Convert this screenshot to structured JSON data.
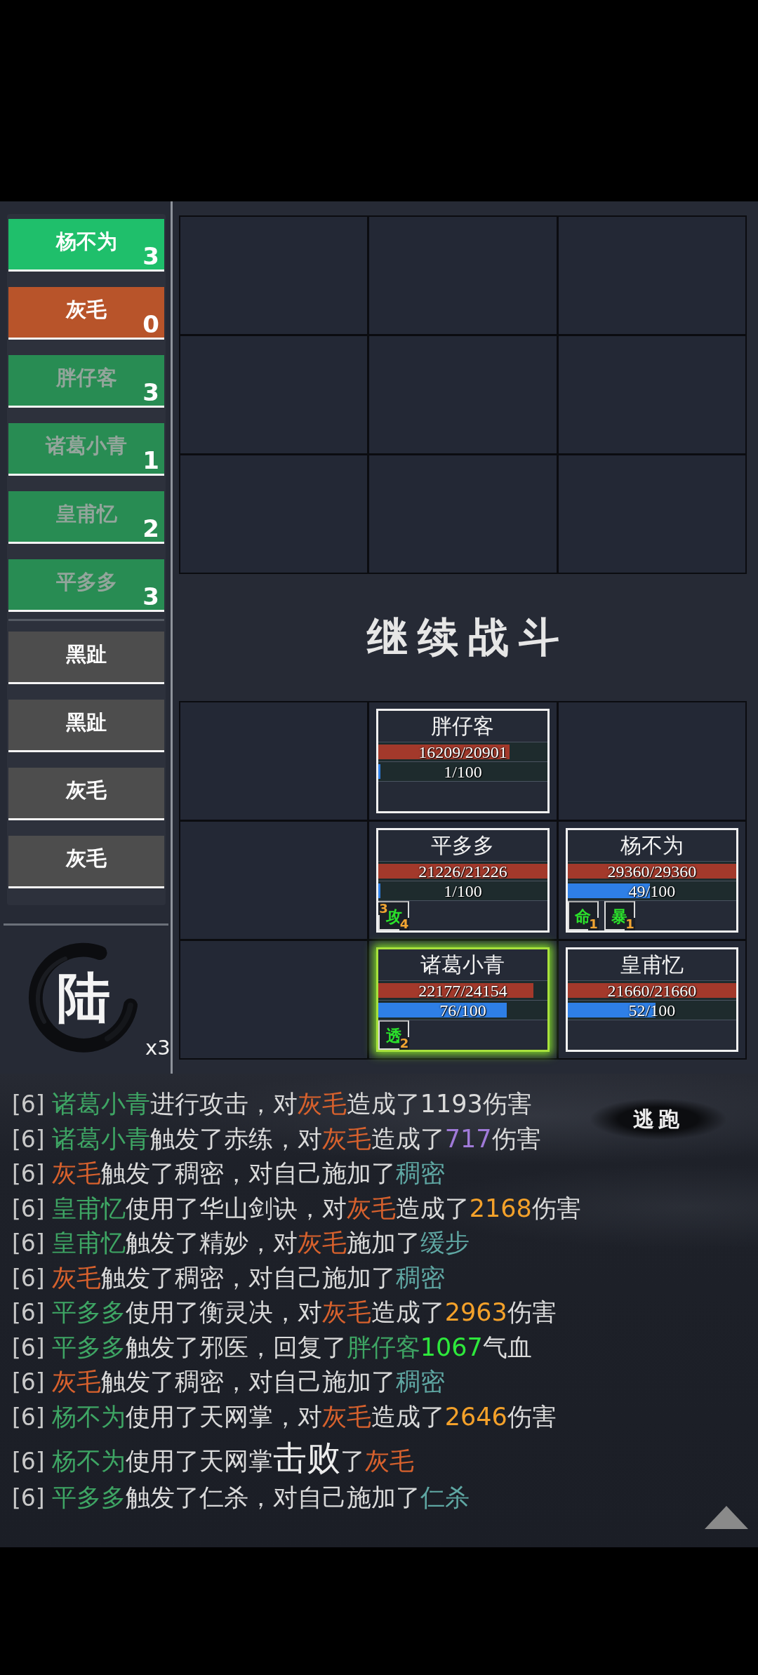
{
  "battle_queue": {
    "groups": [
      {
        "items": [
          {
            "name": "杨不为",
            "count": "3",
            "color": "#1fbf6b",
            "dimmed": false
          },
          {
            "name": "灰毛",
            "count": "0",
            "color": "#b8542a",
            "dimmed": false
          },
          {
            "name": "胖仔客",
            "count": "3",
            "color": "#288c53",
            "dimmed": true
          },
          {
            "name": "诸葛小青",
            "count": "1",
            "color": "#288c53",
            "dimmed": true
          },
          {
            "name": "皇甫忆",
            "count": "2",
            "color": "#288c53",
            "dimmed": true
          },
          {
            "name": "平多多",
            "count": "3",
            "color": "#288c53",
            "dimmed": true
          }
        ]
      },
      {
        "items": [
          {
            "name": "黑趾",
            "color": "#4d4d4d",
            "dimmed": false
          },
          {
            "name": "黑趾",
            "color": "#4d4d4d",
            "dimmed": false
          },
          {
            "name": "灰毛",
            "color": "#4d4d4d",
            "dimmed": false
          },
          {
            "name": "灰毛",
            "color": "#4d4d4d",
            "dimmed": false
          }
        ]
      }
    ]
  },
  "round_indicator": {
    "numeral": "陆",
    "speed": "x3"
  },
  "enemy_formation": {
    "slots": [
      {
        "occupied": false
      },
      {
        "occupied": false
      },
      {
        "occupied": false
      },
      {
        "occupied": false
      },
      {
        "occupied": false
      },
      {
        "occupied": false
      },
      {
        "occupied": false
      },
      {
        "occupied": false
      },
      {
        "occupied": false
      }
    ]
  },
  "continue_button": "继续战斗",
  "ally_formation": {
    "slots": [
      {
        "occupied": false
      },
      {
        "occupied": true,
        "name": "胖仔客",
        "hp": {
          "text": "16209/20901",
          "level": 0.775
        },
        "energy": {
          "text": "1/100",
          "level": 0.01
        },
        "active": false
      },
      {
        "occupied": false
      },
      {
        "occupied": false
      },
      {
        "occupied": true,
        "name": "平多多",
        "hp": {
          "text": "21226/21226",
          "level": 1
        },
        "energy": {
          "text": "1/100",
          "level": 0.01
        },
        "buffs": [
          {
            "glyph": "攻",
            "top_number": "3",
            "bottom_number": "4"
          }
        ],
        "active": false
      },
      {
        "occupied": true,
        "name": "杨不为",
        "hp": {
          "text": "29360/29360",
          "level": 1
        },
        "energy": {
          "text": "49/100",
          "level": 0.49
        },
        "buffs": [
          {
            "glyph": "命",
            "bottom_number": "1"
          },
          {
            "glyph": "暴",
            "bottom_number": "1"
          }
        ],
        "active": false
      },
      {
        "occupied": false
      },
      {
        "occupied": true,
        "name": "诸葛小青",
        "hp": {
          "text": "22177/24154",
          "level": 0.918
        },
        "energy": {
          "text": "76/100",
          "level": 0.76
        },
        "buffs": [
          {
            "glyph": "透",
            "bottom_number": "2"
          }
        ],
        "active": true
      },
      {
        "occupied": true,
        "name": "皇甫忆",
        "hp": {
          "text": "21660/21660",
          "level": 1
        },
        "energy": {
          "text": "52/100",
          "level": 0.52
        },
        "active": false
      }
    ]
  },
  "battle_log": {
    "lines": [
      {
        "round": "[6]",
        "segments": [
          {
            "kind": "ally",
            "text": "诸葛小青"
          },
          {
            "kind": "text",
            "text": "进行攻击，对"
          },
          {
            "kind": "enemy",
            "text": "灰毛"
          },
          {
            "kind": "text",
            "text": "造成了1193伤害"
          }
        ]
      },
      {
        "round": "[6]",
        "segments": [
          {
            "kind": "ally",
            "text": "诸葛小青"
          },
          {
            "kind": "text",
            "text": "触发了赤练，对"
          },
          {
            "kind": "enemy",
            "text": "灰毛"
          },
          {
            "kind": "text",
            "text": "造成了"
          },
          {
            "kind": "magic",
            "text": "717"
          },
          {
            "kind": "text",
            "text": "伤害"
          }
        ]
      },
      {
        "round": "[6]",
        "segments": [
          {
            "kind": "enemy",
            "text": "灰毛"
          },
          {
            "kind": "text",
            "text": "触发了稠密，对自己施加了"
          },
          {
            "kind": "status",
            "text": "稠密"
          }
        ]
      },
      {
        "round": "[6]",
        "segments": [
          {
            "kind": "ally",
            "text": "皇甫忆"
          },
          {
            "kind": "text",
            "text": "使用了华山剑诀，对"
          },
          {
            "kind": "enemy",
            "text": "灰毛"
          },
          {
            "kind": "text",
            "text": "造成了"
          },
          {
            "kind": "damage",
            "text": "2168"
          },
          {
            "kind": "text",
            "text": "伤害"
          }
        ]
      },
      {
        "round": "[6]",
        "segments": [
          {
            "kind": "ally",
            "text": "皇甫忆"
          },
          {
            "kind": "text",
            "text": "触发了精妙，对"
          },
          {
            "kind": "enemy",
            "text": "灰毛"
          },
          {
            "kind": "text",
            "text": "施加了"
          },
          {
            "kind": "status",
            "text": "缓步"
          }
        ]
      },
      {
        "round": "[6]",
        "segments": [
          {
            "kind": "enemy",
            "text": "灰毛"
          },
          {
            "kind": "text",
            "text": "触发了稠密，对自己施加了"
          },
          {
            "kind": "status",
            "text": "稠密"
          }
        ]
      },
      {
        "round": "[6]",
        "segments": [
          {
            "kind": "ally",
            "text": "平多多"
          },
          {
            "kind": "text",
            "text": "使用了衡灵决，对"
          },
          {
            "kind": "enemy",
            "text": "灰毛"
          },
          {
            "kind": "text",
            "text": "造成了"
          },
          {
            "kind": "damage",
            "text": "2963"
          },
          {
            "kind": "text",
            "text": "伤害"
          }
        ]
      },
      {
        "round": "[6]",
        "segments": [
          {
            "kind": "ally",
            "text": "平多多"
          },
          {
            "kind": "text",
            "text": "触发了邪医，回复了"
          },
          {
            "kind": "ally",
            "text": "胖仔客"
          },
          {
            "kind": "heal",
            "text": "1067"
          },
          {
            "kind": "text",
            "text": "气血"
          }
        ]
      },
      {
        "round": "[6]",
        "segments": [
          {
            "kind": "enemy",
            "text": "灰毛"
          },
          {
            "kind": "text",
            "text": "触发了稠密，对自己施加了"
          },
          {
            "kind": "status",
            "text": "稠密"
          }
        ]
      },
      {
        "round": "[6]",
        "segments": [
          {
            "kind": "ally",
            "text": "杨不为"
          },
          {
            "kind": "text",
            "text": "使用了天网掌，对"
          },
          {
            "kind": "enemy",
            "text": "灰毛"
          },
          {
            "kind": "text",
            "text": "造成了"
          },
          {
            "kind": "damage",
            "text": "2646"
          },
          {
            "kind": "text",
            "text": "伤害"
          }
        ]
      },
      {
        "round": "[6]",
        "segments": [
          {
            "kind": "ally",
            "text": "杨不为"
          },
          {
            "kind": "text",
            "text": "使用了天网掌"
          },
          {
            "kind": "emphasis",
            "text": "击败"
          },
          {
            "kind": "text",
            "text": "了"
          },
          {
            "kind": "enemy",
            "text": "灰毛"
          }
        ]
      },
      {
        "round": "[6]",
        "segments": [
          {
            "kind": "ally",
            "text": "平多多"
          },
          {
            "kind": "text",
            "text": "触发了仁杀，对自己施加了"
          },
          {
            "kind": "status",
            "text": "仁杀"
          }
        ]
      }
    ]
  },
  "flee_button": "逃跑"
}
